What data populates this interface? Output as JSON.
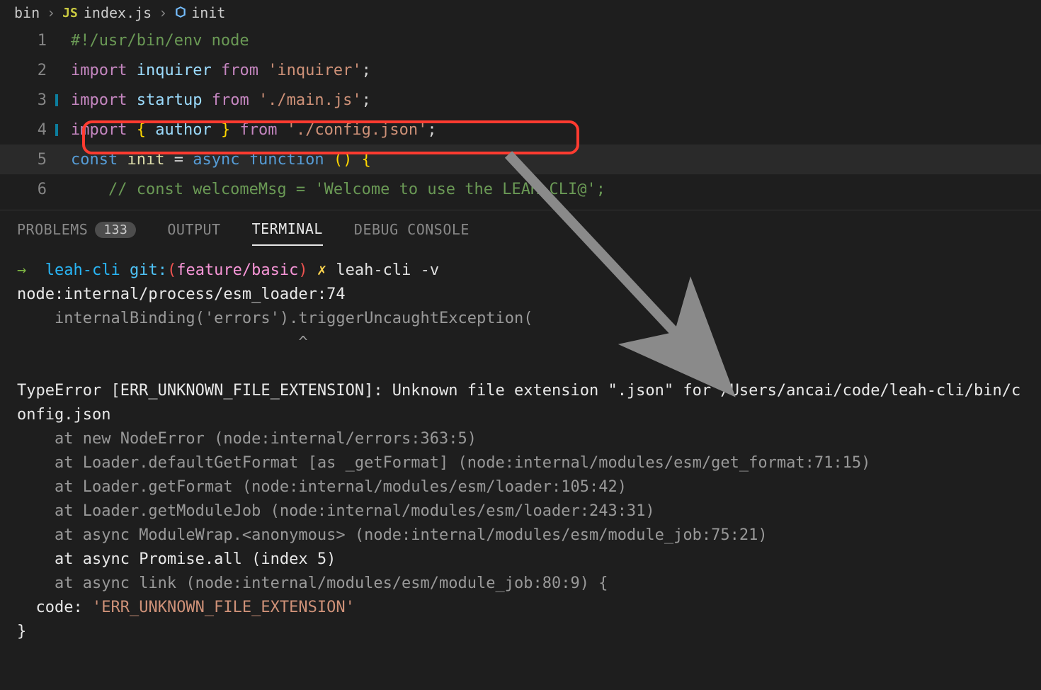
{
  "breadcrumb": {
    "folder": "bin",
    "file_icon_label": "JS",
    "file": "index.js",
    "symbol": "init"
  },
  "editor": {
    "lines": [
      {
        "n": 1,
        "tokens": [
          [
            "tk-comment",
            "#!/usr/bin/env node"
          ]
        ]
      },
      {
        "n": 2,
        "tokens": [
          [
            "tk-keyword",
            "import"
          ],
          [
            "tk-punc",
            " "
          ],
          [
            "tk-var",
            "inquirer"
          ],
          [
            "tk-punc",
            " "
          ],
          [
            "tk-keyword",
            "from"
          ],
          [
            "tk-punc",
            " "
          ],
          [
            "tk-string",
            "'inquirer'"
          ],
          [
            "tk-punc",
            ";"
          ]
        ]
      },
      {
        "n": 3,
        "modified": true,
        "tokens": [
          [
            "tk-keyword",
            "import"
          ],
          [
            "tk-punc",
            " "
          ],
          [
            "tk-var",
            "startup"
          ],
          [
            "tk-punc",
            " "
          ],
          [
            "tk-keyword",
            "from"
          ],
          [
            "tk-punc",
            " "
          ],
          [
            "tk-string",
            "'./main.js'"
          ],
          [
            "tk-punc",
            ";"
          ]
        ]
      },
      {
        "n": 4,
        "modified": true,
        "tokens": [
          [
            "tk-keyword",
            "import"
          ],
          [
            "tk-punc",
            " "
          ],
          [
            "tk-bracket-y",
            "{"
          ],
          [
            "tk-punc",
            " "
          ],
          [
            "tk-var",
            "author"
          ],
          [
            "tk-punc",
            " "
          ],
          [
            "tk-bracket-y",
            "}"
          ],
          [
            "tk-punc",
            " "
          ],
          [
            "tk-keyword",
            "from"
          ],
          [
            "tk-punc",
            " "
          ],
          [
            "tk-string",
            "'./config.json'"
          ],
          [
            "tk-punc",
            ";"
          ]
        ]
      },
      {
        "n": 5,
        "hl": true,
        "tokens": [
          [
            "tk-type",
            "const"
          ],
          [
            "tk-punc",
            " "
          ],
          [
            "tk-fn",
            "init"
          ],
          [
            "tk-punc",
            " = "
          ],
          [
            "tk-type",
            "async"
          ],
          [
            "tk-punc",
            " "
          ],
          [
            "tk-type",
            "function"
          ],
          [
            "tk-punc",
            " "
          ],
          [
            "tk-bracket-y",
            "()"
          ],
          [
            "tk-punc",
            " "
          ],
          [
            "tk-bracket-y",
            "{"
          ]
        ]
      },
      {
        "n": 6,
        "indent": true,
        "tokens": [
          [
            "tk-punc",
            "    "
          ],
          [
            "tk-comment",
            "// const welcomeMsg = 'Welcome to use the LEAH CLI@';"
          ]
        ]
      }
    ]
  },
  "panel": {
    "tabs": {
      "problems": "PROBLEMS",
      "problems_count": "133",
      "output": "OUTPUT",
      "terminal": "TERMINAL",
      "debug": "DEBUG CONSOLE"
    }
  },
  "terminal": {
    "prompt_arrow": "→",
    "project": "leah-cli",
    "git_label": "git:(",
    "branch": "feature/basic",
    "git_close": ")",
    "dirty": "✗",
    "command": "leah-cli -v",
    "loader_line": "node:internal/process/esm_loader:74",
    "binding_line": "    internalBinding('errors').triggerUncaughtException(",
    "caret_line": "                              ^",
    "error_head": "TypeError [ERR_UNKNOWN_FILE_EXTENSION]: Unknown file extension \".json\" for /Users/ancai/code/leah-cli/bin/config.json",
    "stack": [
      "    at new NodeError (node:internal/errors:363:5)",
      "    at Loader.defaultGetFormat [as _getFormat] (node:internal/modules/esm/get_format:71:15)",
      "    at Loader.getFormat (node:internal/modules/esm/loader:105:42)",
      "    at Loader.getModuleJob (node:internal/modules/esm/loader:243:31)",
      "    at async ModuleWrap.<anonymous> (node:internal/modules/esm/module_job:75:21)"
    ],
    "stack_bright": "    at async Promise.all (index 5)",
    "stack_tail": "    at async link (node:internal/modules/esm/module_job:80:9) {",
    "code_label": "  code: ",
    "code_value": "'ERR_UNKNOWN_FILE_EXTENSION'",
    "close_brace": "}"
  }
}
